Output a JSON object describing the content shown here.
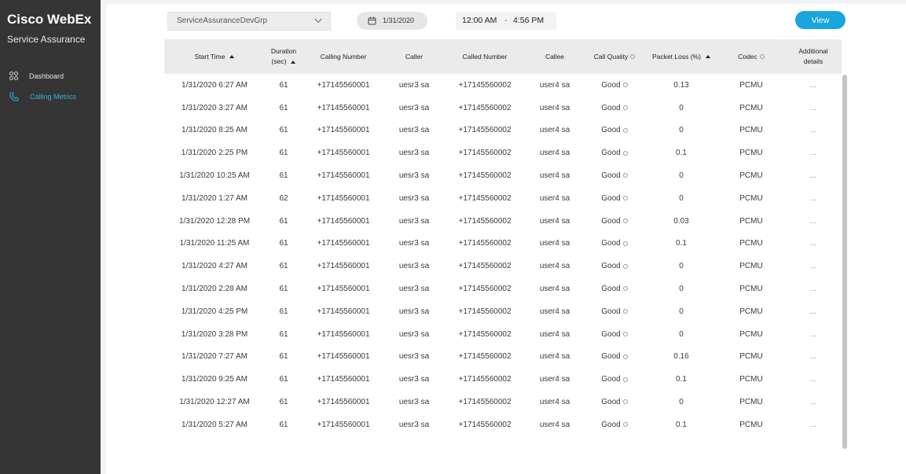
{
  "sidebar": {
    "brand": "Cisco WebEx",
    "subbrand": "Service Assurance",
    "items": [
      {
        "label": "Dashboard",
        "icon": "grid-icon"
      },
      {
        "label": "Calling Metrics",
        "icon": "phone-icon",
        "active": true
      }
    ]
  },
  "filters": {
    "group": "ServiceAssuranceDevGrp",
    "date": "1/31/2020",
    "time_start": "12:00 AM",
    "time_separator": "-",
    "time_end": "4:56 PM",
    "view_label": "View"
  },
  "table": {
    "headers": {
      "start_time": "Start Time",
      "duration_line1": "Duration",
      "duration_line2": "(sec)",
      "calling_number": "Calling Number",
      "caller": "Caller",
      "called_number": "Called Number",
      "callee": "Callee",
      "call_quality": "Call Quality",
      "packet_loss": "Packet Loss (%)",
      "codec": "Codec",
      "details_line1": "Additional",
      "details_line2": "details"
    },
    "rows": [
      [
        "1/31/2020 6:27 AM",
        "61",
        "+17145560001",
        "uesr3 sa",
        "+17145560002",
        "user4 sa",
        "Good",
        "0.13",
        "PCMU",
        "..."
      ],
      [
        "1/31/2020 3:27 AM",
        "61",
        "+17145560001",
        "uesr3 sa",
        "+17145560002",
        "user4 sa",
        "Good",
        "0",
        "PCMU",
        "..."
      ],
      [
        "1/31/2020 8:25 AM",
        "61",
        "+17145560001",
        "uesr3 sa",
        "+17145560002",
        "user4 sa",
        "Good",
        "0",
        "PCMU",
        "..."
      ],
      [
        "1/31/2020 2:25 PM",
        "61",
        "+17145560001",
        "uesr3 sa",
        "+17145560002",
        "user4 sa",
        "Good",
        "0.1",
        "PCMU",
        "..."
      ],
      [
        "1/31/2020 10:25 AM",
        "61",
        "+17145560001",
        "uesr3 sa",
        "+17145560002",
        "user4 sa",
        "Good",
        "0",
        "PCMU",
        "..."
      ],
      [
        "1/31/2020 1:27 AM",
        "62",
        "+17145560001",
        "uesr3 sa",
        "+17145560002",
        "user4 sa",
        "Good",
        "0",
        "PCMU",
        "..."
      ],
      [
        "1/31/2020 12:28 PM",
        "61",
        "+17145560001",
        "uesr3 sa",
        "+17145560002",
        "user4 sa",
        "Good",
        "0.03",
        "PCMU",
        "..."
      ],
      [
        "1/31/2020 11:25 AM",
        "61",
        "+17145560001",
        "uesr3 sa",
        "+17145560002",
        "user4 sa",
        "Good",
        "0.1",
        "PCMU",
        "..."
      ],
      [
        "1/31/2020 4:27 AM",
        "61",
        "+17145560001",
        "uesr3 sa",
        "+17145560002",
        "user4 sa",
        "Good",
        "0",
        "PCMU",
        "..."
      ],
      [
        "1/31/2020 2:28 AM",
        "61",
        "+17145560001",
        "uesr3 sa",
        "+17145560002",
        "user4 sa",
        "Good",
        "0",
        "PCMU",
        "..."
      ],
      [
        "1/31/2020 4:25 PM",
        "61",
        "+17145560001",
        "uesr3 sa",
        "+17145560002",
        "user4 sa",
        "Good",
        "0",
        "PCMU",
        "..."
      ],
      [
        "1/31/2020 3:28 PM",
        "61",
        "+17145560001",
        "uesr3 sa",
        "+17145560002",
        "user4 sa",
        "Good",
        "0",
        "PCMU",
        "..."
      ],
      [
        "1/31/2020 7:27 AM",
        "61",
        "+17145560001",
        "uesr3 sa",
        "+17145560002",
        "user4 sa",
        "Good",
        "0.16",
        "PCMU",
        "..."
      ],
      [
        "1/31/2020 9:25 AM",
        "61",
        "+17145560001",
        "uesr3 sa",
        "+17145560002",
        "user4 sa",
        "Good",
        "0.1",
        "PCMU",
        "..."
      ],
      [
        "1/31/2020 12:27 AM",
        "61",
        "+17145560001",
        "uesr3 sa",
        "+17145560002",
        "user4 sa",
        "Good",
        "0",
        "PCMU",
        "..."
      ],
      [
        "1/31/2020 5:27 AM",
        "61",
        "+17145560001",
        "uesr3 sa",
        "+17145560002",
        "user4 sa",
        "Good",
        "0.1",
        "PCMU",
        "..."
      ]
    ]
  },
  "colors": {
    "sidebar_bg": "#353535",
    "accent": "#19a6dc",
    "active_nav": "#2fb3d6",
    "header_bg": "#ebebeb"
  }
}
